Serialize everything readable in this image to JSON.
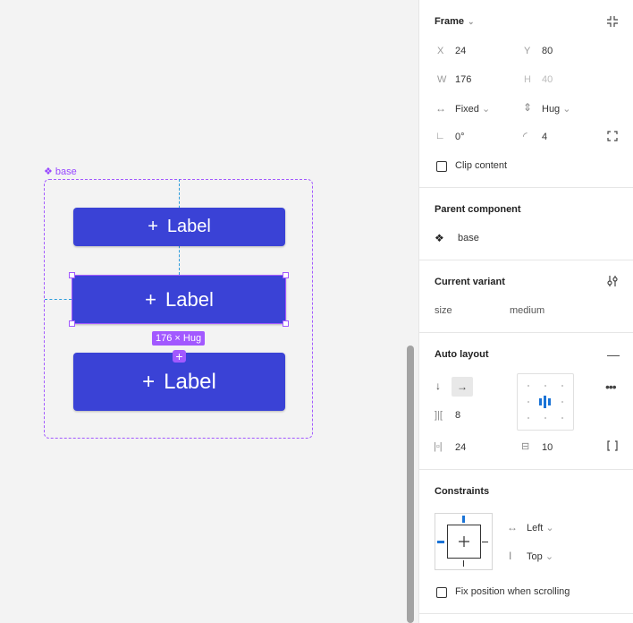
{
  "canvas": {
    "component_tag": "base",
    "buttons": [
      {
        "plus": "+",
        "label": "Label"
      },
      {
        "plus": "+",
        "label": "Label"
      },
      {
        "plus": "+",
        "label": "Label"
      }
    ],
    "size_badge": "176 × Hug",
    "add_handle": "+"
  },
  "frame": {
    "title": "Frame",
    "x_label": "X",
    "x": "24",
    "y_label": "Y",
    "y": "80",
    "w_label": "W",
    "w": "176",
    "h_label": "H",
    "h": "40",
    "h_sizing": "Fixed",
    "v_sizing": "Hug",
    "rotation": "0°",
    "radius": "4",
    "clip_content": "Clip content"
  },
  "parent_component": {
    "title": "Parent component",
    "name": "base"
  },
  "current_variant": {
    "title": "Current variant",
    "property": "size",
    "value": "medium"
  },
  "auto_layout": {
    "title": "Auto layout",
    "gap": "8",
    "h_padding": "24",
    "v_padding": "10"
  },
  "constraints": {
    "title": "Constraints",
    "horizontal": "Left",
    "vertical": "Top",
    "fix_position": "Fix position when scrolling"
  }
}
